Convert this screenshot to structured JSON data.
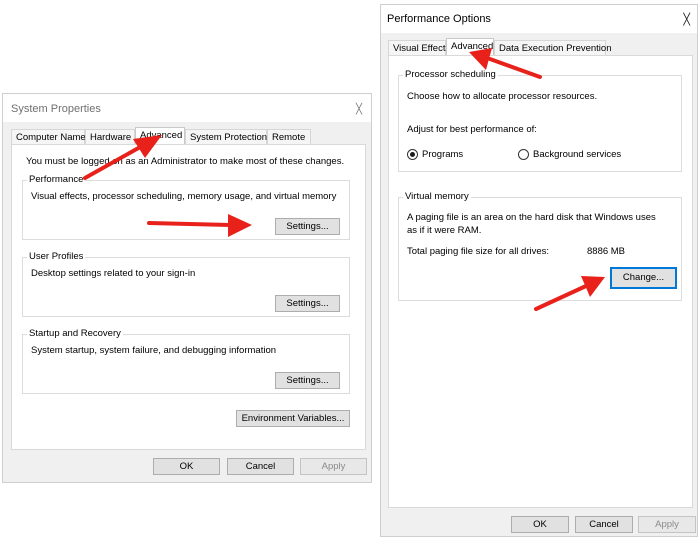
{
  "system_properties": {
    "title": "System Properties",
    "close_glyph": "╳",
    "tabs": [
      {
        "label": "Computer Name"
      },
      {
        "label": "Hardware"
      },
      {
        "label": "Advanced"
      },
      {
        "label": "System Protection"
      },
      {
        "label": "Remote"
      }
    ],
    "admin_notice": "You must be logged on as an Administrator to make most of these changes.",
    "performance": {
      "title": "Performance",
      "description": "Visual effects, processor scheduling, memory usage, and virtual memory",
      "settings_label": "Settings..."
    },
    "user_profiles": {
      "title": "User Profiles",
      "description": "Desktop settings related to your sign-in",
      "settings_label": "Settings..."
    },
    "startup_recovery": {
      "title": "Startup and Recovery",
      "description": "System startup, system failure, and debugging information",
      "settings_label": "Settings..."
    },
    "env_vars_label": "Environment Variables...",
    "ok_label": "OK",
    "cancel_label": "Cancel",
    "apply_label": "Apply"
  },
  "performance_options": {
    "title": "Performance Options",
    "close_glyph": "╳",
    "tabs": [
      {
        "label": "Visual Effects"
      },
      {
        "label": "Advanced"
      },
      {
        "label": "Data Execution Prevention"
      }
    ],
    "processor_scheduling": {
      "title": "Processor scheduling",
      "description": "Choose how to allocate processor resources.",
      "adjust_label": "Adjust for best performance of:",
      "option_programs": "Programs",
      "option_background": "Background services",
      "selected": "Programs"
    },
    "virtual_memory": {
      "title": "Virtual memory",
      "description_line1": "A paging file is an area on the hard disk that Windows uses",
      "description_line2": "as if it were RAM.",
      "total_label": "Total paging file size for all drives:",
      "total_value": "8886 MB",
      "change_label": "Change..."
    },
    "ok_label": "OK",
    "cancel_label": "Cancel",
    "apply_label": "Apply"
  },
  "colors": {
    "annotation_arrow": "#e8211b",
    "focus_border": "#0078d7"
  }
}
